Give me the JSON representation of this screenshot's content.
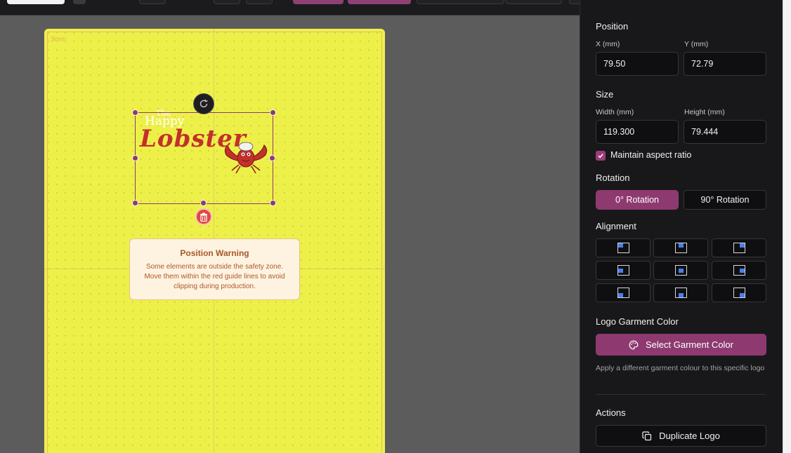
{
  "canvas": {
    "bleed_label": "3mm",
    "logo": {
      "line1": "The",
      "line2": "Happy",
      "line3": "Lobster"
    },
    "warning": {
      "title": "Position Warning",
      "body": "Some elements are outside the safety zone. Move them within the red guide lines to avoid clipping during production."
    },
    "garment_color": "#eef04a"
  },
  "panel": {
    "position": {
      "title": "Position",
      "x_label": "X (mm)",
      "x_value": "79.50",
      "y_label": "Y (mm)",
      "y_value": "72.79"
    },
    "size": {
      "title": "Size",
      "width_label": "Width (mm)",
      "width_value": "119.300",
      "height_label": "Height (mm)",
      "height_value": "79.444",
      "aspect_label": "Maintain aspect ratio",
      "aspect_checked": true
    },
    "rotation": {
      "title": "Rotation",
      "option_0": "0° Rotation",
      "option_90": "90° Rotation",
      "selected": "0° Rotation"
    },
    "alignment": {
      "title": "Alignment"
    },
    "garment_color": {
      "title": "Logo Garment Color",
      "button": "Select Garment Color",
      "helper": "Apply a different garment colour to this specific logo"
    },
    "actions": {
      "title": "Actions",
      "duplicate": "Duplicate Logo"
    }
  },
  "colors": {
    "accent": "#8e3a70",
    "alignment_dot": "#4b7cf0",
    "warning_bg": "#fdf3e0"
  }
}
